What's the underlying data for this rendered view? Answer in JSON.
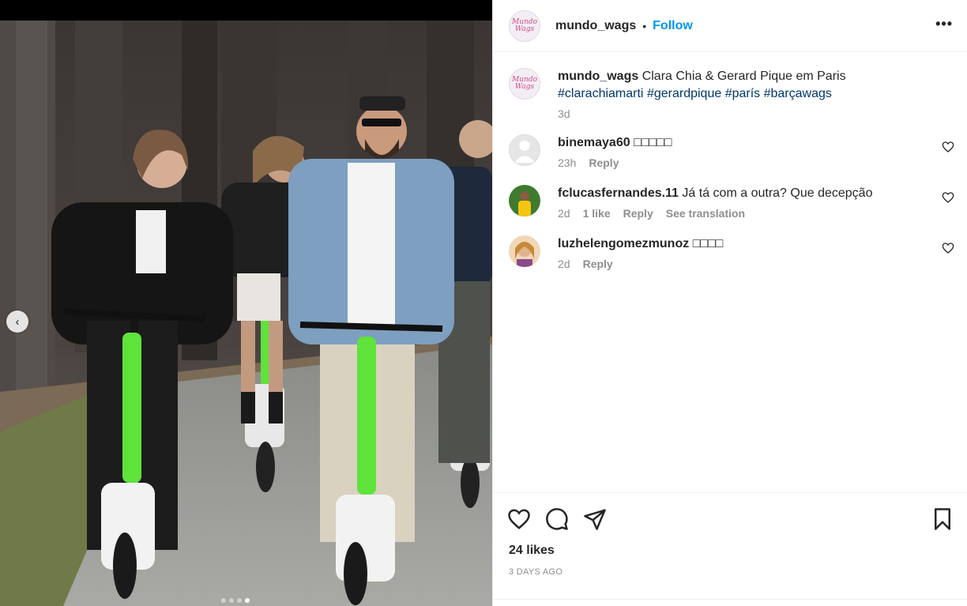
{
  "post": {
    "username": "mundo_wags",
    "separator": "•",
    "follow_label": "Follow",
    "more_label": "•••",
    "brand_avatar_text": [
      "Mundo",
      "Wags"
    ],
    "caption": {
      "username": "mundo_wags",
      "text": "Clara Chia & Gerard Pique em Paris",
      "hashtags": [
        "#clarachiamarti",
        "#gerardpique",
        "#parís",
        "#barçawags"
      ],
      "time": "3d"
    }
  },
  "comments": [
    {
      "username": "binemaya60",
      "text": "□□□□□",
      "time": "23h",
      "likes": "",
      "reply_label": "Reply",
      "translation_label": ""
    },
    {
      "username": "fclucasfernandes.11",
      "text": "Já tá com a outra? Que decepção",
      "time": "2d",
      "likes": "1 like",
      "reply_label": "Reply",
      "translation_label": "See translation"
    },
    {
      "username": "luzhelengomezmunoz",
      "text": "□□□□",
      "time": "2d",
      "likes": "",
      "reply_label": "Reply",
      "translation_label": ""
    }
  ],
  "actions": {
    "likes_label": "24 likes",
    "timeago": "3 DAYS AGO"
  },
  "carousel": {
    "prev_icon": "chevron-left-icon",
    "prev_glyph": "‹",
    "dots": 4,
    "active_dot": 3
  },
  "colors": {
    "follow": "#0095f6",
    "hashtag": "#00376b",
    "meta": "#8e8e8e",
    "scooter_green": "#5fe23a"
  }
}
